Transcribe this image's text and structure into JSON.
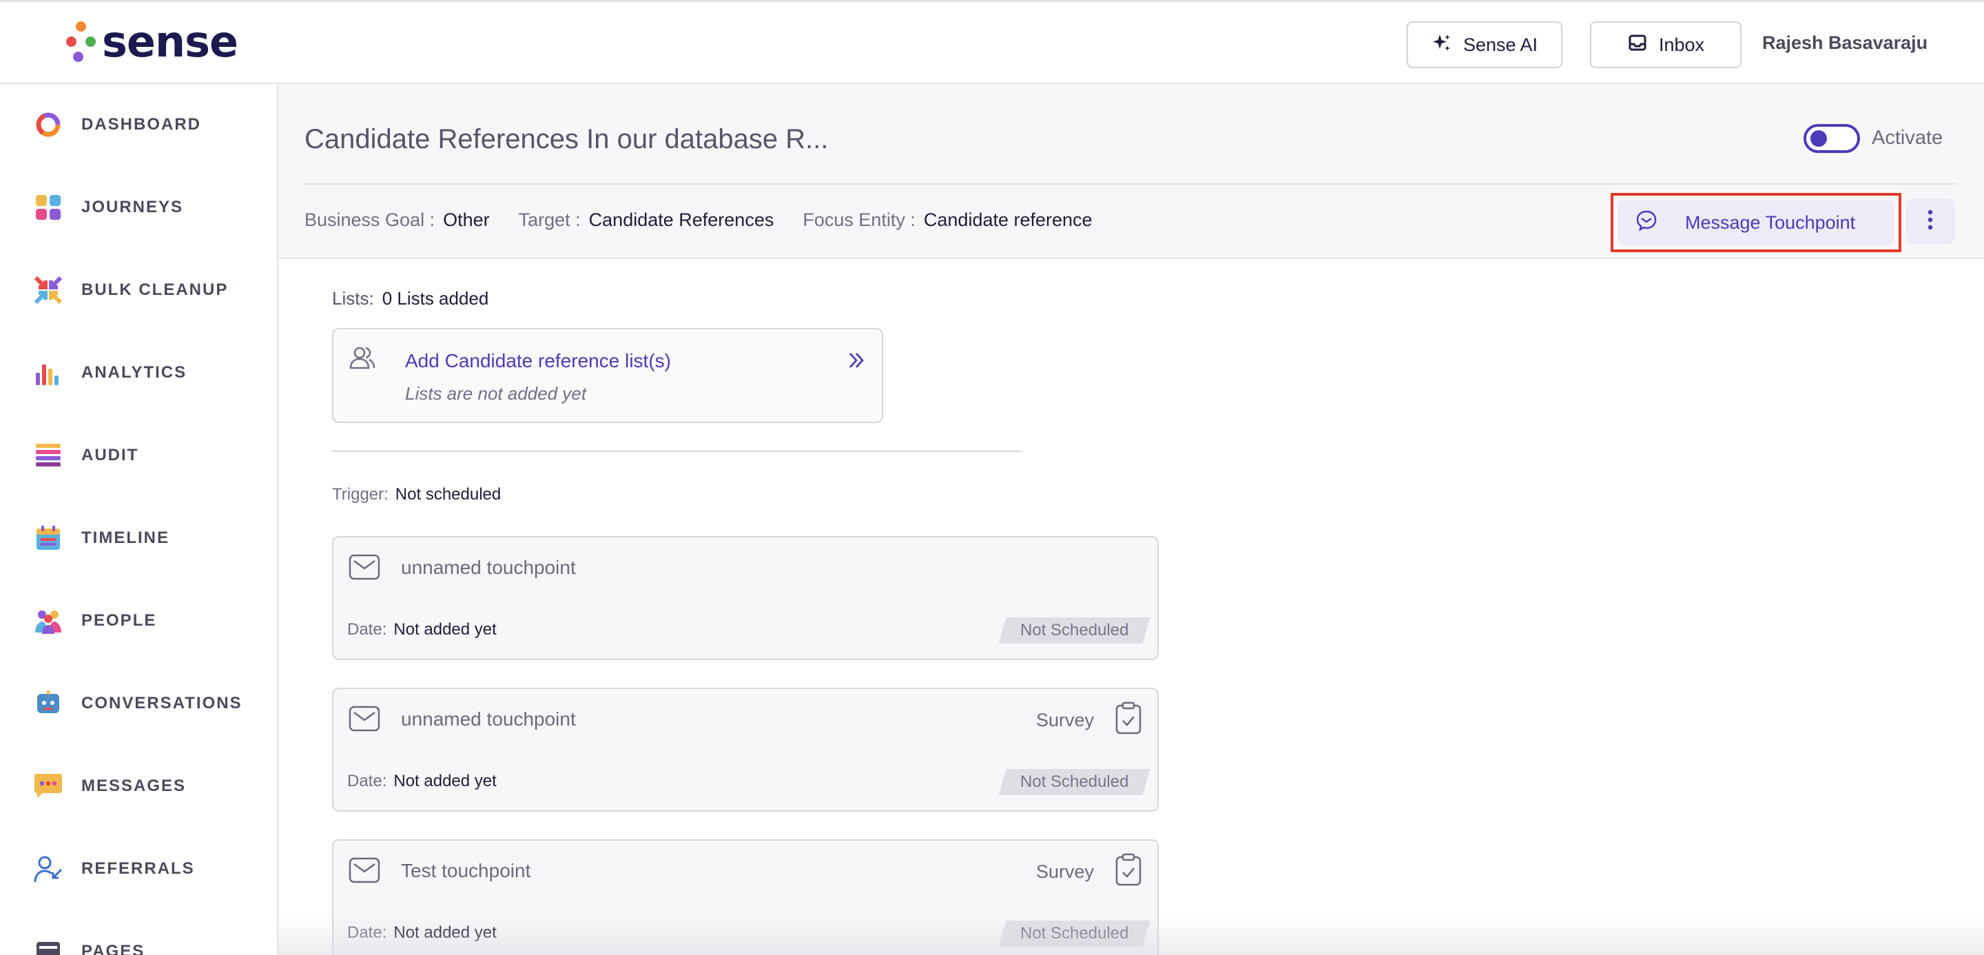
{
  "header": {
    "logo_text": "sense",
    "sense_ai_label": "Sense AI",
    "inbox_label": "Inbox",
    "user_name": "Rajesh Basavaraju"
  },
  "sidebar": {
    "items": [
      {
        "label": "DASHBOARD",
        "icon": "donut-icon"
      },
      {
        "label": "JOURNEYS",
        "icon": "grid-tiles-icon"
      },
      {
        "label": "BULK CLEANUP",
        "icon": "arrows-inward-icon"
      },
      {
        "label": "ANALYTICS",
        "icon": "bar-chart-icon"
      },
      {
        "label": "AUDIT",
        "icon": "stacked-list-icon"
      },
      {
        "label": "TIMELINE",
        "icon": "calendar-icon"
      },
      {
        "label": "PEOPLE",
        "icon": "people-group-icon"
      },
      {
        "label": "CONVERSATIONS",
        "icon": "robot-chat-icon"
      },
      {
        "label": "MESSAGES",
        "icon": "message-bubble-icon"
      },
      {
        "label": "REFERRALS",
        "icon": "user-arrow-icon"
      },
      {
        "label": "PAGES",
        "icon": "page-icon"
      }
    ]
  },
  "journey": {
    "title": "Candidate References In our database R...",
    "activate_label": "Activate",
    "meta": {
      "business_goal_key": "Business Goal :",
      "business_goal_val": "Other",
      "target_key": "Target :",
      "target_val": "Candidate References",
      "focus_key": "Focus Entity :",
      "focus_val": "Candidate reference"
    },
    "message_touchpoint_label": "Message Touchpoint"
  },
  "lists": {
    "key": "Lists:",
    "value": "0 Lists added",
    "add_title": "Add Candidate reference list(s)",
    "add_subtitle": "Lists are not added yet"
  },
  "trigger": {
    "key": "Trigger:",
    "value": "Not scheduled"
  },
  "touchpoints": [
    {
      "name": "unnamed touchpoint",
      "type": "",
      "date_key": "Date:",
      "date_val": "Not added yet",
      "status": "Not Scheduled"
    },
    {
      "name": "unnamed touchpoint",
      "type": "Survey",
      "date_key": "Date:",
      "date_val": "Not added yet",
      "status": "Not Scheduled"
    },
    {
      "name": "Test touchpoint",
      "type": "Survey",
      "date_key": "Date:",
      "date_val": "Not added yet",
      "status": "Not Scheduled"
    }
  ],
  "colors": {
    "accent": "#4b3bb8",
    "highlight_border": "#e03c2b",
    "logo_text": "#1d1a4f"
  }
}
